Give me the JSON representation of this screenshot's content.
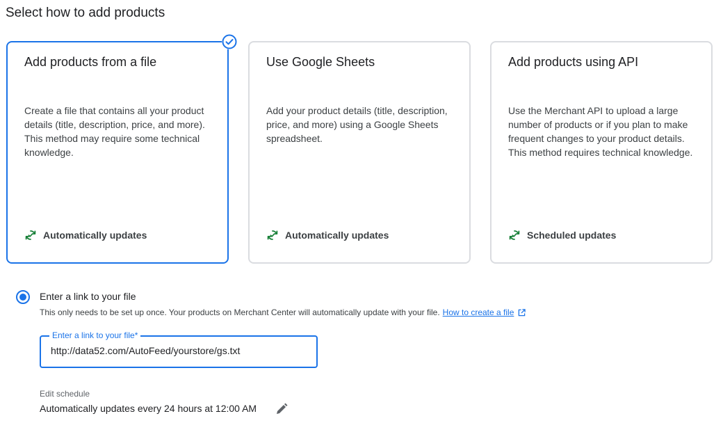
{
  "page": {
    "title": "Select how to add products"
  },
  "cards": [
    {
      "title": "Add products from a file",
      "description": "Create a file that contains all your product details (title, description, price, and more). This method may require some technical knowledge.",
      "footer": "Automatically updates",
      "selected": true,
      "icon": "sync-icon"
    },
    {
      "title": "Use Google Sheets",
      "description": "Add your product details (title, description, price, and more) using a Google Sheets spreadsheet.",
      "footer": "Automatically updates",
      "selected": false,
      "icon": "sync-icon"
    },
    {
      "title": "Add products using API",
      "description": "Use the Merchant API to upload a large number of products or if you plan to make frequent changes to your product details. This method requires technical knowledge.",
      "footer": "Scheduled updates",
      "selected": false,
      "icon": "sync-icon"
    }
  ],
  "link_option": {
    "label": "Enter a link to your file",
    "help_text": "This only needs to be set up once. Your products on Merchant Center will automatically update with your file.",
    "help_link": "How to create a file",
    "field_label": "Enter a link to your file*",
    "field_value": "http://data52.com/AutoFeed/yourstore/gs.txt"
  },
  "schedule": {
    "label": "Edit schedule",
    "value": "Automatically updates every 24 hours at 12:00 AM"
  },
  "colors": {
    "accent": "#1a73e8",
    "sync_icon": "#188038",
    "border": "#dadce0"
  }
}
